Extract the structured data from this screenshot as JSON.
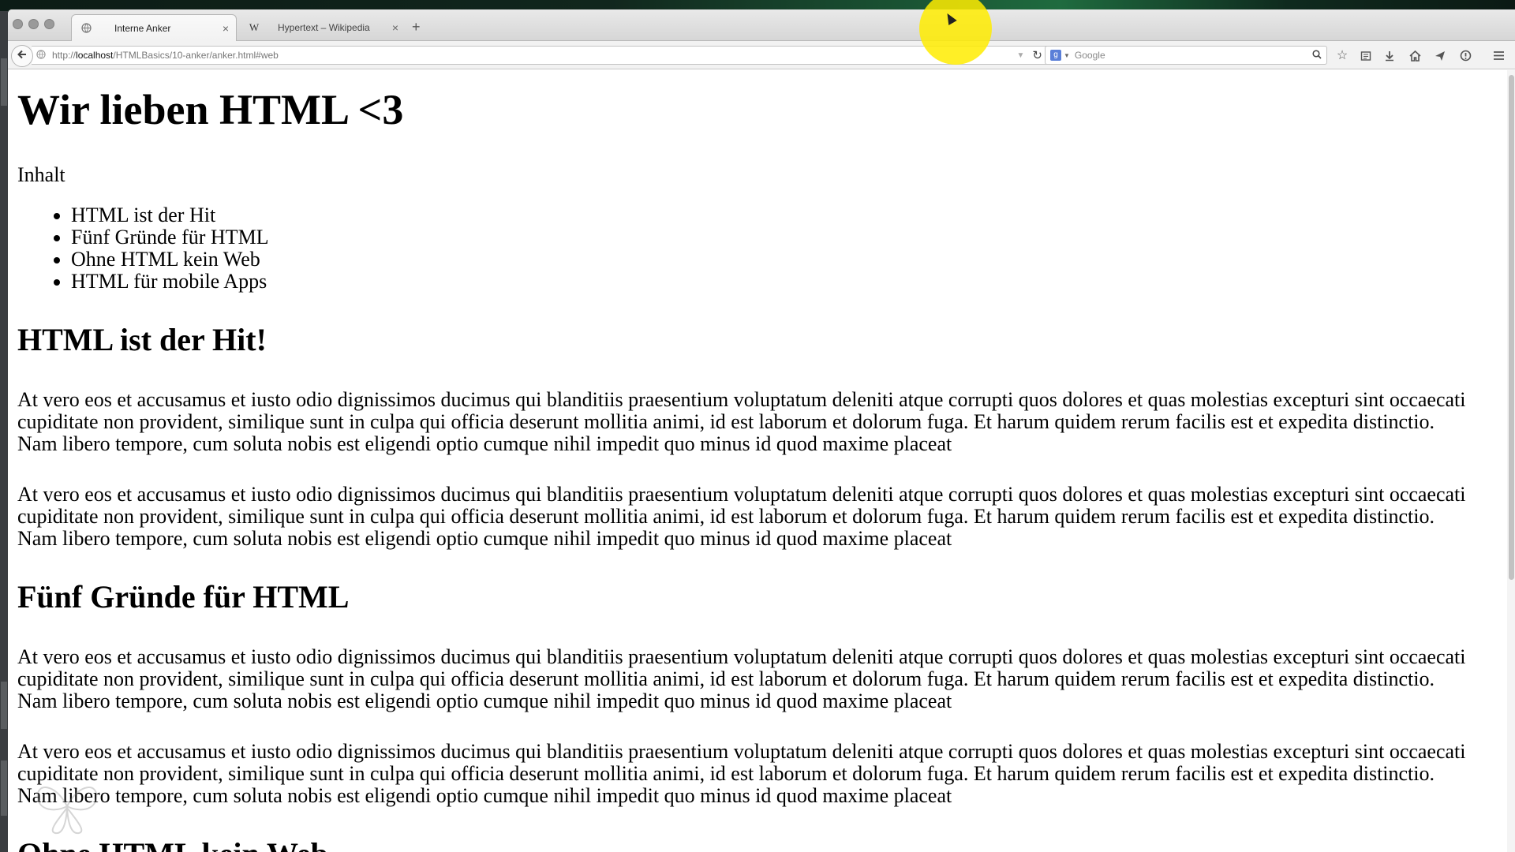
{
  "browser": {
    "tabs": [
      {
        "title": "Interne Anker",
        "favicon": "globe-icon",
        "active": true
      },
      {
        "title": "Hypertext – Wikipedia",
        "favicon": "wikipedia-w-icon",
        "active": false
      }
    ],
    "url": {
      "prefix": "http://",
      "host": "localhost",
      "path": "/HTMLBasics/10-anker/anker.html#web"
    },
    "search": {
      "placeholder": "Google",
      "engine_icon": "google-icon"
    },
    "toolbar_icons": [
      "bookmark-star-icon",
      "reading-list-icon",
      "download-icon",
      "home-icon",
      "send-icon",
      "info-icon",
      "menu-icon"
    ]
  },
  "page": {
    "h1": "Wir lieben HTML <3",
    "toc_title": "Inhalt",
    "toc_items": [
      "HTML ist der Hit",
      "Fünf Gründe für HTML",
      "Ohne HTML kein Web",
      "HTML für mobile Apps"
    ],
    "sections": [
      {
        "heading": "HTML ist der Hit!",
        "paragraphs": [
          "At vero eos et accusamus et iusto odio dignissimos ducimus qui blanditiis praesentium voluptatum deleniti atque corrupti quos dolores et quas molestias excepturi sint occaecati cupiditate non provident, similique sunt in culpa qui officia deserunt mollitia animi, id est laborum et dolorum fuga. Et harum quidem rerum facilis est et expedita distinctio. Nam libero tempore, cum soluta nobis est eligendi optio cumque nihil impedit quo minus id quod maxime placeat",
          "At vero eos et accusamus et iusto odio dignissimos ducimus qui blanditiis praesentium voluptatum deleniti atque corrupti quos dolores et quas molestias excepturi sint occaecati cupiditate non provident, similique sunt in culpa qui officia deserunt mollitia animi, id est laborum et dolorum fuga. Et harum quidem rerum facilis est et expedita distinctio. Nam libero tempore, cum soluta nobis est eligendi optio cumque nihil impedit quo minus id quod maxime placeat"
        ]
      },
      {
        "heading": "Fünf Gründe für HTML",
        "paragraphs": [
          "At vero eos et accusamus et iusto odio dignissimos ducimus qui blanditiis praesentium voluptatum deleniti atque corrupti quos dolores et quas molestias excepturi sint occaecati cupiditate non provident, similique sunt in culpa qui officia deserunt mollitia animi, id est laborum et dolorum fuga. Et harum quidem rerum facilis est et expedita distinctio. Nam libero tempore, cum soluta nobis est eligendi optio cumque nihil impedit quo minus id quod maxime placeat",
          "At vero eos et accusamus et iusto odio dignissimos ducimus qui blanditiis praesentium voluptatum deleniti atque corrupti quos dolores et quas molestias excepturi sint occaecati cupiditate non provident, similique sunt in culpa qui officia deserunt mollitia animi, id est laborum et dolorum fuga. Et harum quidem rerum facilis est et expedita distinctio. Nam libero tempore, cum soluta nobis est eligendi optio cumque nihil impedit quo minus id quod maxime placeat"
        ]
      },
      {
        "heading": "Ohne HTML kein Web",
        "paragraphs": []
      }
    ]
  },
  "colors": {
    "cursor_highlight": "#ffec00",
    "page_background": "#ffffff",
    "text": "#000000"
  }
}
